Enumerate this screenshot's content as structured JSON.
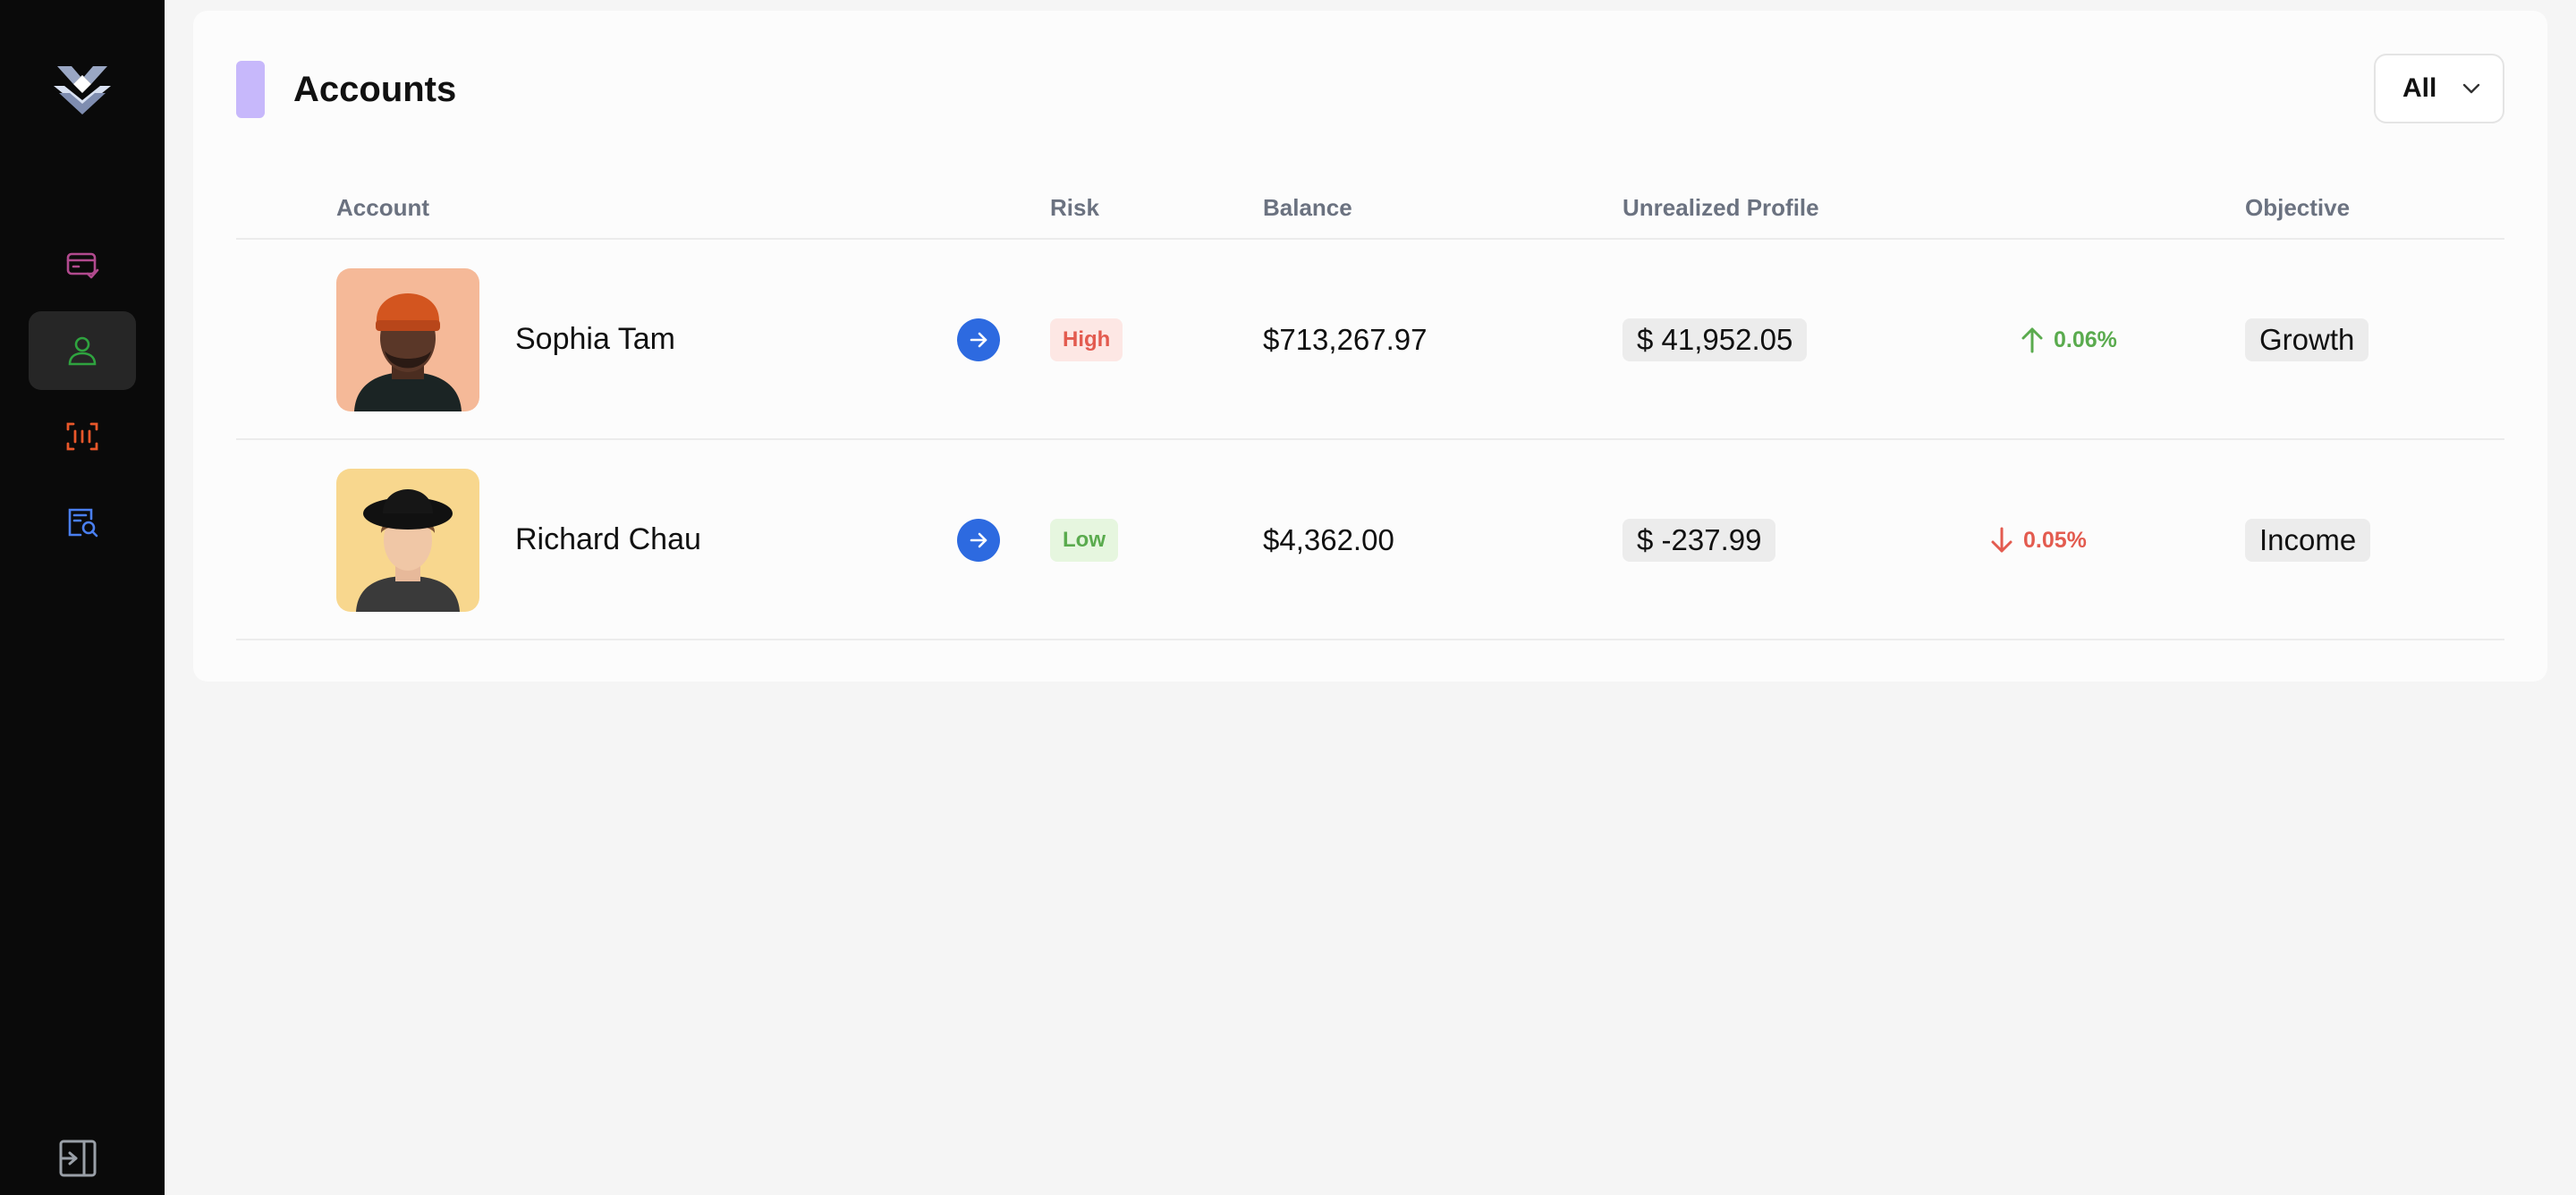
{
  "sidebar": {
    "items": [
      {
        "icon": "card-check-icon",
        "color": "#b14a8e"
      },
      {
        "icon": "user-icon",
        "color": "#2fa33f",
        "active": true
      },
      {
        "icon": "scan-icon",
        "color": "#e8572a"
      },
      {
        "icon": "report-search-icon",
        "color": "#4a7ff0"
      }
    ],
    "logout_icon": "logout-icon"
  },
  "header": {
    "title": "Accounts",
    "accent_color": "#c7b8fb",
    "filter": {
      "selected": "All"
    }
  },
  "table": {
    "columns": {
      "account": "Account",
      "risk": "Risk",
      "balance": "Balance",
      "unrealized": "Unrealized Profile",
      "objective": "Objective"
    },
    "rows": [
      {
        "name": "Sophia Tam",
        "risk": "High",
        "risk_color": "#e35b4f",
        "risk_bg": "#fde7e4",
        "balance": "$713,267.97",
        "unrealized": "$ 41,952.05",
        "change": "0.06%",
        "direction": "up",
        "change_color": "#5aab4e",
        "objective": "Growth"
      },
      {
        "name": "Richard Chau",
        "risk": "Low",
        "risk_color": "#5aab4e",
        "risk_bg": "#e6f6df",
        "balance": "$4,362.00",
        "unrealized": "$ -237.99",
        "change": "0.05%",
        "direction": "down",
        "change_color": "#e35b4f",
        "objective": "Income"
      }
    ]
  }
}
